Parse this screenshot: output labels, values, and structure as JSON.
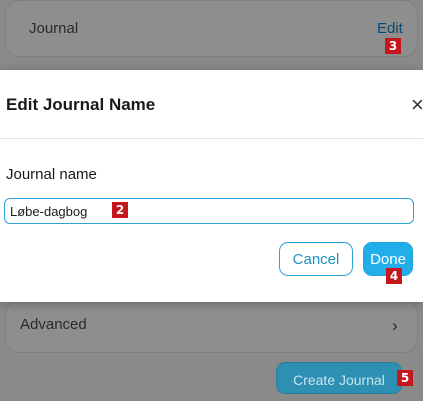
{
  "background": {
    "journal_row_label": "Journal",
    "edit_link": "Edit",
    "advanced_label": "Advanced",
    "advanced_chevron": "›",
    "create_button": "Create Journal"
  },
  "dialog": {
    "title": "Edit Journal Name",
    "close_glyph": "×",
    "field_label": "Journal name",
    "field_value": "Løbe-dagbog",
    "cancel_label": "Cancel",
    "done_label": "Done"
  },
  "badges": {
    "edit": "3",
    "input": "2",
    "done": "4",
    "create": "5"
  },
  "colors": {
    "accent": "#22aee8",
    "badge": "#c5161d",
    "overlay": "#8a8a8a"
  }
}
